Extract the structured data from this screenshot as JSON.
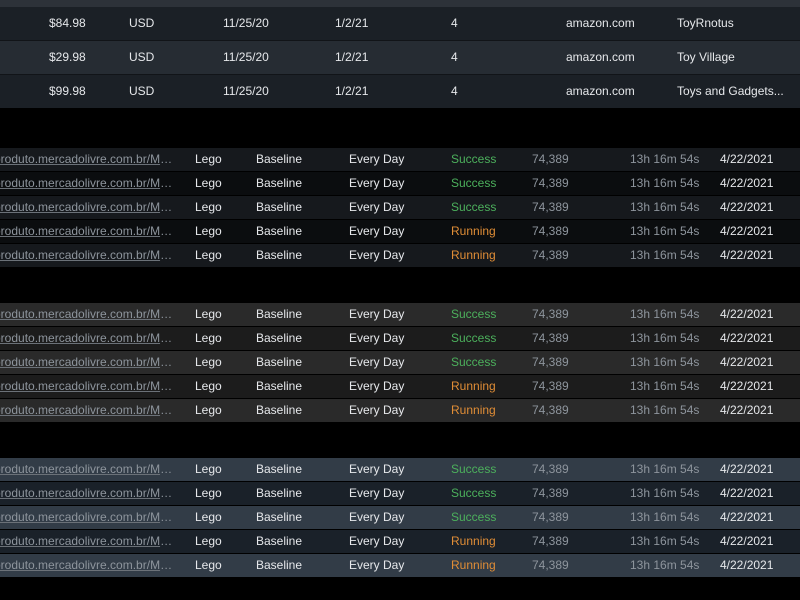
{
  "table_top": {
    "rows": [
      {
        "price": "$84.98",
        "currency": "USD",
        "start": "11/25/20",
        "end": "1/2/21",
        "count": "4",
        "site": "amazon.com",
        "store": "ToyRnotus"
      },
      {
        "price": "$29.98",
        "currency": "USD",
        "start": "11/25/20",
        "end": "1/2/21",
        "count": "4",
        "site": "amazon.com",
        "store": "Toy Village"
      },
      {
        "price": "$99.98",
        "currency": "USD",
        "start": "11/25/20",
        "end": "1/2/21",
        "count": "4",
        "site": "amazon.com",
        "store": "Toys and Gadgets..."
      }
    ]
  },
  "groups": [
    {
      "rows": [
        {
          "url": "produto.mercadolivre.com.br/MLB-...",
          "brand": "Lego",
          "type": "Baseline",
          "frequency": "Every Day",
          "status": "Success",
          "records": "74,389",
          "duration": "13h 16m 54s",
          "date": "4/22/2021"
        },
        {
          "url": "produto.mercadolivre.com.br/MLB-...",
          "brand": "Lego",
          "type": "Baseline",
          "frequency": "Every Day",
          "status": "Success",
          "records": "74,389",
          "duration": "13h 16m 54s",
          "date": "4/22/2021"
        },
        {
          "url": "produto.mercadolivre.com.br/MLB-...",
          "brand": "Lego",
          "type": "Baseline",
          "frequency": "Every Day",
          "status": "Success",
          "records": "74,389",
          "duration": "13h 16m 54s",
          "date": "4/22/2021"
        },
        {
          "url": "produto.mercadolivre.com.br/MLB-...",
          "brand": "Lego",
          "type": "Baseline",
          "frequency": "Every Day",
          "status": "Running",
          "records": "74,389",
          "duration": "13h 16m 54s",
          "date": "4/22/2021"
        },
        {
          "url": "produto.mercadolivre.com.br/MLB-...",
          "brand": "Lego",
          "type": "Baseline",
          "frequency": "Every Day",
          "status": "Running",
          "records": "74,389",
          "duration": "13h 16m 54s",
          "date": "4/22/2021"
        }
      ]
    },
    {
      "rows": [
        {
          "url": "produto.mercadolivre.com.br/MLB-...",
          "brand": "Lego",
          "type": "Baseline",
          "frequency": "Every Day",
          "status": "Success",
          "records": "74,389",
          "duration": "13h 16m 54s",
          "date": "4/22/2021"
        },
        {
          "url": "produto.mercadolivre.com.br/MLB-...",
          "brand": "Lego",
          "type": "Baseline",
          "frequency": "Every Day",
          "status": "Success",
          "records": "74,389",
          "duration": "13h 16m 54s",
          "date": "4/22/2021"
        },
        {
          "url": "produto.mercadolivre.com.br/MLB-...",
          "brand": "Lego",
          "type": "Baseline",
          "frequency": "Every Day",
          "status": "Success",
          "records": "74,389",
          "duration": "13h 16m 54s",
          "date": "4/22/2021"
        },
        {
          "url": "produto.mercadolivre.com.br/MLB-...",
          "brand": "Lego",
          "type": "Baseline",
          "frequency": "Every Day",
          "status": "Running",
          "records": "74,389",
          "duration": "13h 16m 54s",
          "date": "4/22/2021"
        },
        {
          "url": "produto.mercadolivre.com.br/MLB-...",
          "brand": "Lego",
          "type": "Baseline",
          "frequency": "Every Day",
          "status": "Running",
          "records": "74,389",
          "duration": "13h 16m 54s",
          "date": "4/22/2021"
        }
      ]
    },
    {
      "rows": [
        {
          "url": "produto.mercadolivre.com.br/MLB-...",
          "brand": "Lego",
          "type": "Baseline",
          "frequency": "Every Day",
          "status": "Success",
          "records": "74,389",
          "duration": "13h 16m 54s",
          "date": "4/22/2021"
        },
        {
          "url": "produto.mercadolivre.com.br/MLB-...",
          "brand": "Lego",
          "type": "Baseline",
          "frequency": "Every Day",
          "status": "Success",
          "records": "74,389",
          "duration": "13h 16m 54s",
          "date": "4/22/2021"
        },
        {
          "url": "produto.mercadolivre.com.br/MLB-...",
          "brand": "Lego",
          "type": "Baseline",
          "frequency": "Every Day",
          "status": "Success",
          "records": "74,389",
          "duration": "13h 16m 54s",
          "date": "4/22/2021"
        },
        {
          "url": "produto.mercadolivre.com.br/MLB-...",
          "brand": "Lego",
          "type": "Baseline",
          "frequency": "Every Day",
          "status": "Running",
          "records": "74,389",
          "duration": "13h 16m 54s",
          "date": "4/22/2021"
        },
        {
          "url": "produto.mercadolivre.com.br/MLB-...",
          "brand": "Lego",
          "type": "Baseline",
          "frequency": "Every Day",
          "status": "Running",
          "records": "74,389",
          "duration": "13h 16m 54s",
          "date": "4/22/2021"
        }
      ]
    }
  ],
  "colors": {
    "success": "#4cb05c",
    "running": "#e08d36",
    "background": "#000000"
  }
}
